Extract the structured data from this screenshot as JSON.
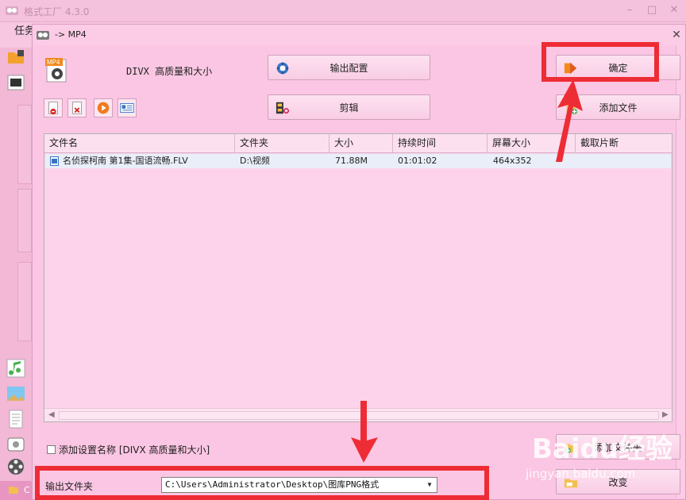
{
  "main_window": {
    "title": "格式工厂 4.3.0",
    "menu_partial": "任务",
    "status_partial": "C",
    "minimize": "–",
    "maximize": "□",
    "close": "✕"
  },
  "dialog": {
    "title": "-> MP4",
    "close": "✕",
    "format_icon_text": "MP4",
    "profile_label": "DIVX 高质量和大小",
    "buttons": {
      "output_config": "输出配置",
      "edit_clip": "剪辑",
      "ok": "确定",
      "add_file": "添加文件",
      "add_folder": "添加文件夹",
      "change": "改变"
    },
    "table": {
      "columns": [
        "文件名",
        "文件夹",
        "大小",
        "持续时间",
        "屏幕大小",
        "截取片断"
      ],
      "rows": [
        {
          "name": "名侦探柯南 第1集-国语流畅.FLV",
          "folder": "D:\\视频",
          "size": "71.88M",
          "duration": "01:01:02",
          "screen": "464x352",
          "clip": ""
        }
      ]
    },
    "checkbox_label": "添加设置名称 [DIVX 高质量和大小]",
    "output_folder_label": "输出文件夹",
    "output_folder_value": "C:\\Users\\Administrator\\Desktop\\图库PNG格式"
  },
  "watermark": {
    "brand": "Baidu经验",
    "url": "jingyan.baidu.com"
  },
  "colors": {
    "annotation_red": "#ee2c35",
    "dialog_bg": "#fbc6e3",
    "row_highlight": "#e9eef8"
  }
}
